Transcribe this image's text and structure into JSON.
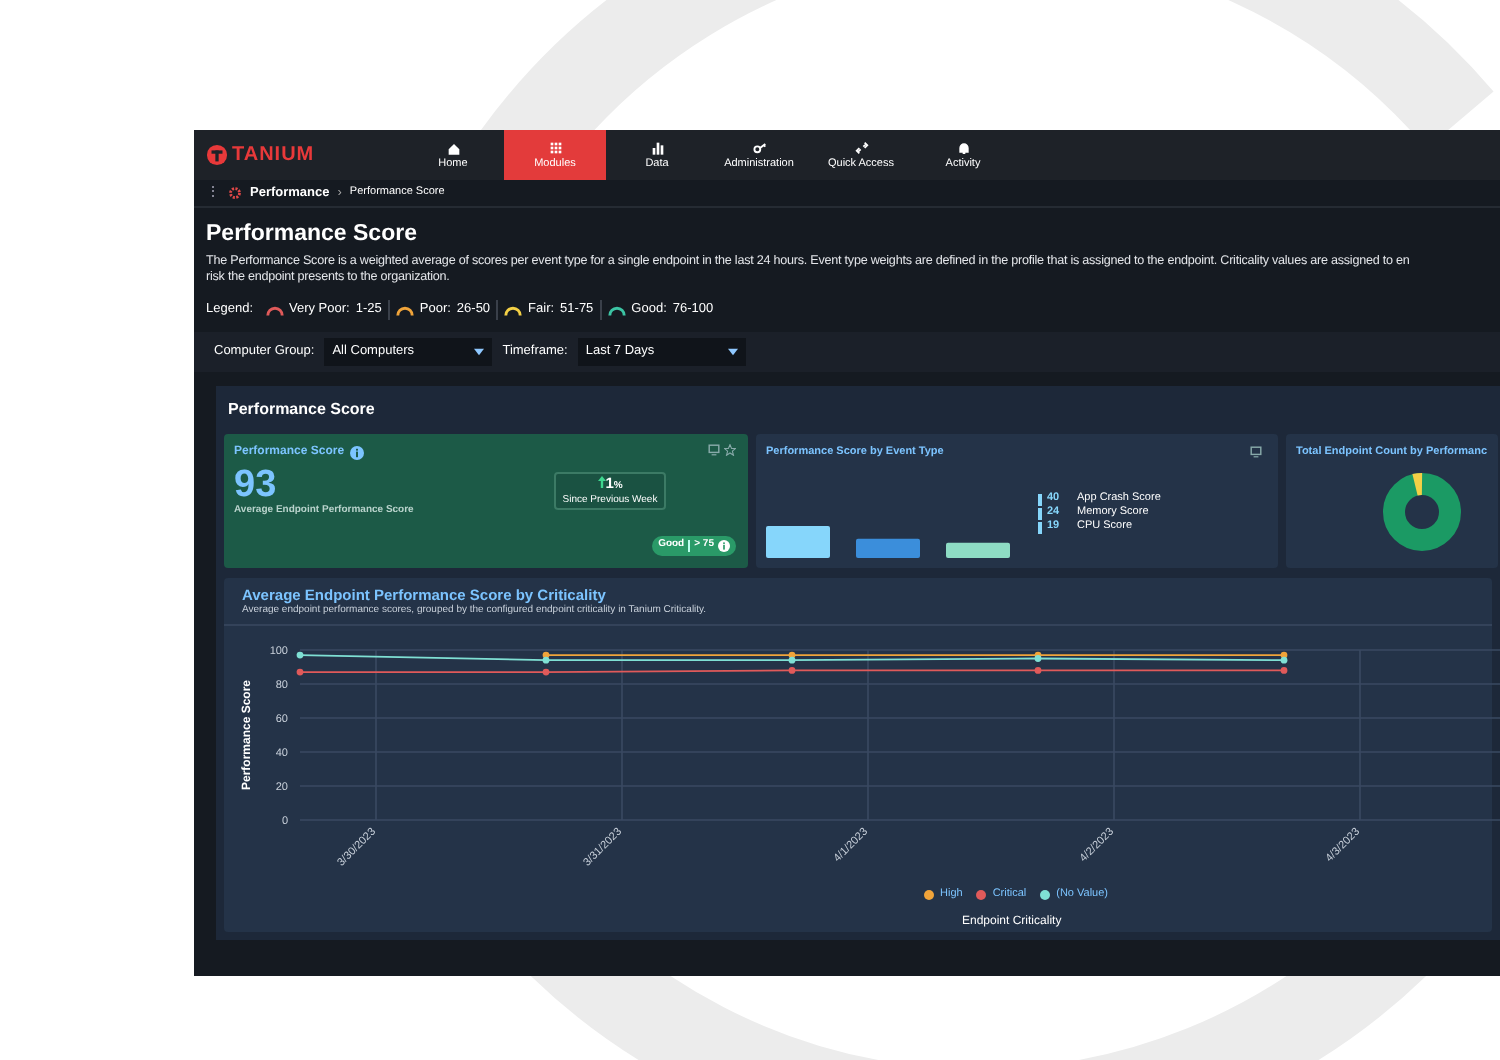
{
  "nav": {
    "logo": "TANIUM",
    "items": [
      {
        "label": "Home",
        "selected": false
      },
      {
        "label": "Modules",
        "selected": true
      },
      {
        "label": "Data",
        "selected": false
      },
      {
        "label": "Administration",
        "selected": false
      },
      {
        "label": "Quick Access",
        "selected": false
      },
      {
        "label": "Activity",
        "selected": false
      }
    ]
  },
  "breadcrumb": {
    "menu": "⋮",
    "module": "Performance",
    "separator": "›",
    "page": "Performance Score"
  },
  "title": "Performance Score",
  "description": [
    "The Performance Score is a weighted average of scores per event type for a single endpoint in the last 24 hours. Event type weights are defined in the profile that is assigned to the endpoint. Criticality values are assigned to en",
    "risk the endpoint presents to the organization."
  ],
  "legend": {
    "label": "Legend:",
    "items": [
      {
        "name": "Very Poor:",
        "range": "1-25",
        "color": "#e05a5a"
      },
      {
        "name": "Poor:",
        "range": "26-50",
        "color": "#f0a43a"
      },
      {
        "name": "Fair:",
        "range": "51-75",
        "color": "#f3d046"
      },
      {
        "name": "Good:",
        "range": "76-100",
        "color": "#3cc4a4"
      }
    ]
  },
  "filters": [
    {
      "label": "Computer Group:",
      "value": "All Computers"
    },
    {
      "label": "Timeframe:",
      "value": "Last 7 Days"
    }
  ],
  "section_title": "Performance Score",
  "score_card": {
    "title": "Performance Score",
    "value": "93",
    "caption": "Average Endpoint Performance Score",
    "change": {
      "value": "1",
      "unit": "%",
      "caption": "Since Previous Week"
    },
    "badge": {
      "label": "Good",
      "threshold": "> 75"
    }
  },
  "event_card": {
    "title": "Performance Score by Event Type",
    "event_types": [
      {
        "value": "40",
        "label": "App Crash Score",
        "color": "#86d6fb"
      },
      {
        "value": "24",
        "label": "Memory Score",
        "color": "#3b8edb"
      },
      {
        "value": "19",
        "label": "CPU Score",
        "color": "#8edcc4"
      }
    ]
  },
  "count_card": {
    "title": "Total Endpoint Count by Performanc"
  },
  "criticality_chart": {
    "title": "Average Endpoint Performance Score by Criticality",
    "subtitle": "Average endpoint performance scores, grouped by the configured endpoint criticality in Tanium Criticality.",
    "chart_data": {
      "type": "line",
      "xlabel": "Endpoint Criticality",
      "ylabel": "Performance Score",
      "categories": [
        "3/30/2023",
        "3/31/2023",
        "4/1/2023",
        "4/2/2023",
        "4/3/2023"
      ],
      "ylim": [
        0,
        100
      ],
      "yticks": [
        0,
        20,
        40,
        60,
        80,
        100
      ],
      "grid": true,
      "series": [
        {
          "name": "High",
          "color": "#f0a43a",
          "marker": true,
          "values": [
            null,
            97,
            97,
            97,
            97
          ]
        },
        {
          "name": "Critical",
          "color": "#e05a5a",
          "marker": true,
          "values": [
            87,
            87,
            88,
            88,
            88
          ]
        },
        {
          "name": "(No Value)",
          "color": "#7fe0d4",
          "marker": true,
          "values": [
            97,
            94,
            94,
            95,
            94
          ]
        }
      ]
    }
  }
}
